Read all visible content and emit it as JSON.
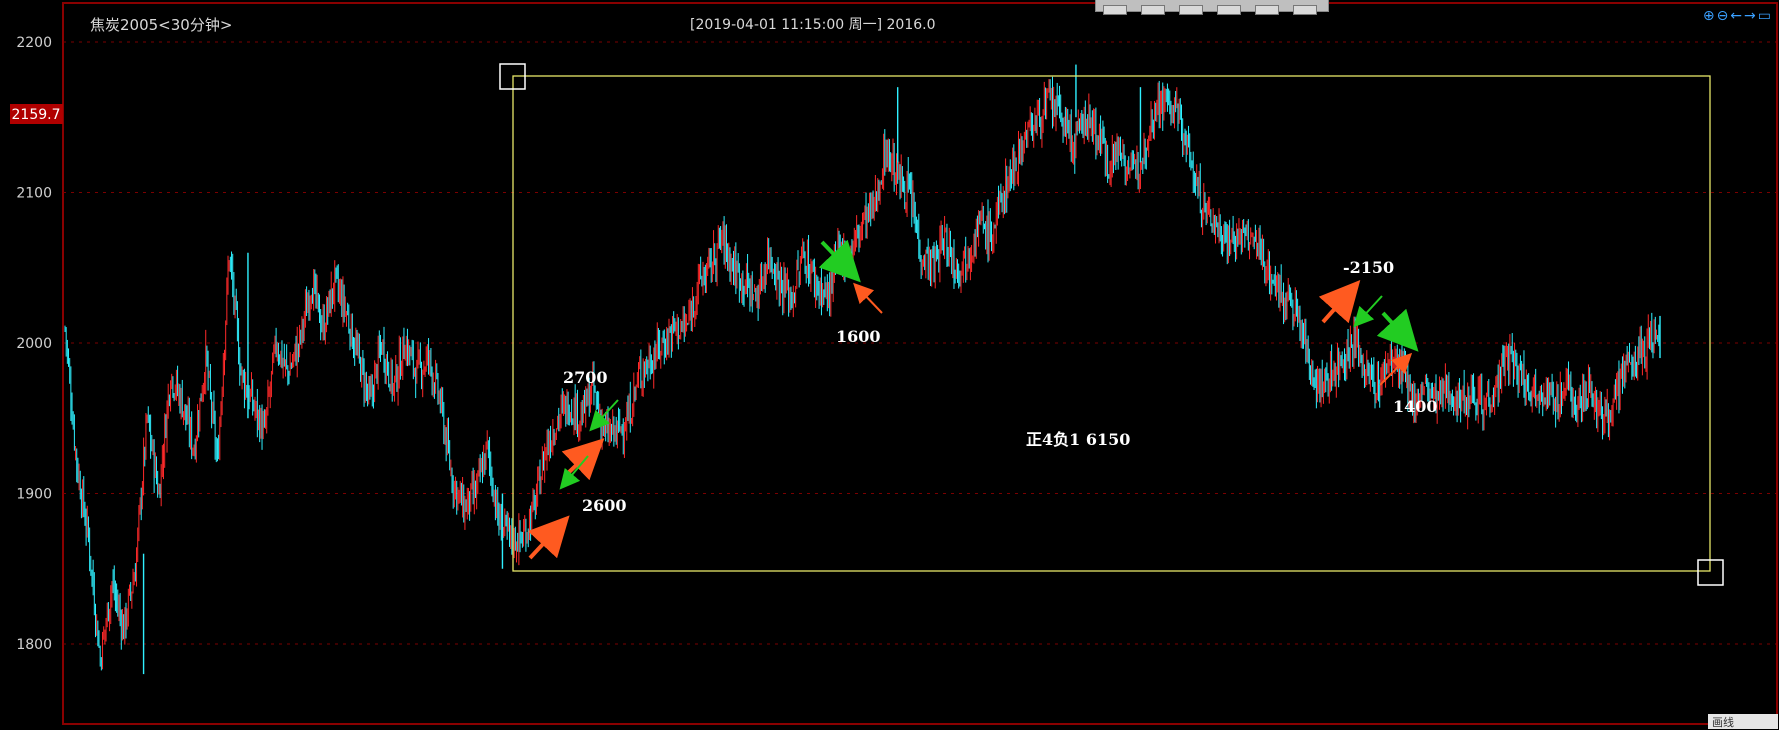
{
  "header": {
    "title": "焦炭2005<30分钟>",
    "info": "[2019-04-01  11:15:00 周一]    2016.0"
  },
  "price_tag": "2159.7",
  "corner_label": "画线",
  "colors": {
    "up": "#ff2a2a",
    "down": "#2ff0ff",
    "grid": "#7a0000",
    "box": "#e8e86a",
    "arrow_red": "#ff5a20",
    "arrow_green": "#22cc22",
    "tag_bg": "#b00000"
  },
  "icons": [
    "zoom-in-icon",
    "zoom-out-icon",
    "scroll-left-icon",
    "scroll-right-icon",
    "window-icon"
  ],
  "annotations": {
    "a2700": "2700",
    "a2600": "2600",
    "a1600": "1600",
    "a2150": "-2150",
    "a1400": "1400",
    "summary": "正4负1  6150"
  },
  "chart_data": {
    "type": "candlestick",
    "y_ticks": [
      2200,
      2100,
      2000,
      1900,
      1800
    ],
    "ylim": [
      1775,
      2225
    ],
    "highlight_price": 2159.7,
    "grid": true,
    "close_path": [
      [
        0,
        2010
      ],
      [
        10,
        1920
      ],
      [
        20,
        1870
      ],
      [
        30,
        1790
      ],
      [
        40,
        1840
      ],
      [
        50,
        1810
      ],
      [
        60,
        1850
      ],
      [
        70,
        1950
      ],
      [
        80,
        1900
      ],
      [
        90,
        1980
      ],
      [
        100,
        1960
      ],
      [
        110,
        1930
      ],
      [
        120,
        1990
      ],
      [
        130,
        1920
      ],
      [
        140,
        2060
      ],
      [
        150,
        1980
      ],
      [
        160,
        1960
      ],
      [
        170,
        1940
      ],
      [
        180,
        2000
      ],
      [
        190,
        1980
      ],
      [
        200,
        2000
      ],
      [
        210,
        2040
      ],
      [
        220,
        2010
      ],
      [
        230,
        2040
      ],
      [
        240,
        2020
      ],
      [
        250,
        1990
      ],
      [
        260,
        1960
      ],
      [
        270,
        2000
      ],
      [
        280,
        1970
      ],
      [
        290,
        2000
      ],
      [
        300,
        1980
      ],
      [
        310,
        1990
      ],
      [
        320,
        1960
      ],
      [
        330,
        1910
      ],
      [
        340,
        1890
      ],
      [
        350,
        1900
      ],
      [
        360,
        1930
      ],
      [
        370,
        1880
      ],
      [
        380,
        1870
      ],
      [
        390,
        1870
      ],
      [
        400,
        1890
      ],
      [
        410,
        1930
      ],
      [
        420,
        1950
      ],
      [
        430,
        1960
      ],
      [
        440,
        1950
      ],
      [
        450,
        1970
      ],
      [
        460,
        1940
      ],
      [
        470,
        1940
      ],
      [
        480,
        1950
      ],
      [
        490,
        1980
      ],
      [
        500,
        1990
      ],
      [
        510,
        2000
      ],
      [
        520,
        2010
      ],
      [
        530,
        2010
      ],
      [
        540,
        2040
      ],
      [
        550,
        2050
      ],
      [
        560,
        2070
      ],
      [
        570,
        2050
      ],
      [
        580,
        2040
      ],
      [
        590,
        2030
      ],
      [
        600,
        2060
      ],
      [
        610,
        2040
      ],
      [
        620,
        2030
      ],
      [
        630,
        2060
      ],
      [
        640,
        2040
      ],
      [
        650,
        2030
      ],
      [
        660,
        2060
      ],
      [
        670,
        2060
      ],
      [
        680,
        2080
      ],
      [
        690,
        2090
      ],
      [
        700,
        2130
      ],
      [
        710,
        2110
      ],
      [
        720,
        2100
      ],
      [
        730,
        2060
      ],
      [
        740,
        2050
      ],
      [
        750,
        2070
      ],
      [
        760,
        2050
      ],
      [
        770,
        2060
      ],
      [
        780,
        2080
      ],
      [
        790,
        2070
      ],
      [
        800,
        2100
      ],
      [
        810,
        2120
      ],
      [
        820,
        2140
      ],
      [
        830,
        2150
      ],
      [
        840,
        2160
      ],
      [
        850,
        2150
      ],
      [
        860,
        2130
      ],
      [
        870,
        2150
      ],
      [
        880,
        2140
      ],
      [
        890,
        2120
      ],
      [
        900,
        2130
      ],
      [
        910,
        2110
      ],
      [
        920,
        2130
      ],
      [
        930,
        2160
      ],
      [
        940,
        2160
      ],
      [
        950,
        2150
      ],
      [
        960,
        2120
      ],
      [
        970,
        2090
      ],
      [
        980,
        2080
      ],
      [
        990,
        2070
      ],
      [
        1000,
        2070
      ],
      [
        1010,
        2070
      ],
      [
        1020,
        2060
      ],
      [
        1030,
        2040
      ],
      [
        1040,
        2030
      ],
      [
        1050,
        2020
      ],
      [
        1060,
        1990
      ],
      [
        1070,
        1970
      ],
      [
        1080,
        1980
      ],
      [
        1090,
        1990
      ],
      [
        1100,
        2000
      ],
      [
        1110,
        1980
      ],
      [
        1120,
        1970
      ],
      [
        1130,
        1990
      ],
      [
        1140,
        1980
      ],
      [
        1150,
        1960
      ],
      [
        1160,
        1970
      ],
      [
        1170,
        1960
      ],
      [
        1180,
        1970
      ],
      [
        1190,
        1960
      ],
      [
        1200,
        1970
      ],
      [
        1210,
        1960
      ],
      [
        1220,
        1970
      ],
      [
        1230,
        1990
      ],
      [
        1240,
        1980
      ],
      [
        1250,
        1970
      ],
      [
        1260,
        1970
      ],
      [
        1270,
        1960
      ],
      [
        1280,
        1970
      ],
      [
        1290,
        1960
      ],
      [
        1300,
        1970
      ],
      [
        1310,
        1950
      ],
      [
        1320,
        1960
      ],
      [
        1330,
        1980
      ],
      [
        1340,
        1990
      ],
      [
        1350,
        2000
      ],
      [
        1360,
        2010
      ]
    ],
    "spikes": [
      [
        67,
        1780,
        1860
      ],
      [
        156,
        2060,
        1950
      ],
      [
        373,
        1850,
        1900
      ],
      [
        710,
        2170,
        2120
      ],
      [
        862,
        2185,
        2150
      ],
      [
        917,
        2170,
        2120
      ],
      [
        1360,
        2018,
        1990
      ]
    ]
  }
}
